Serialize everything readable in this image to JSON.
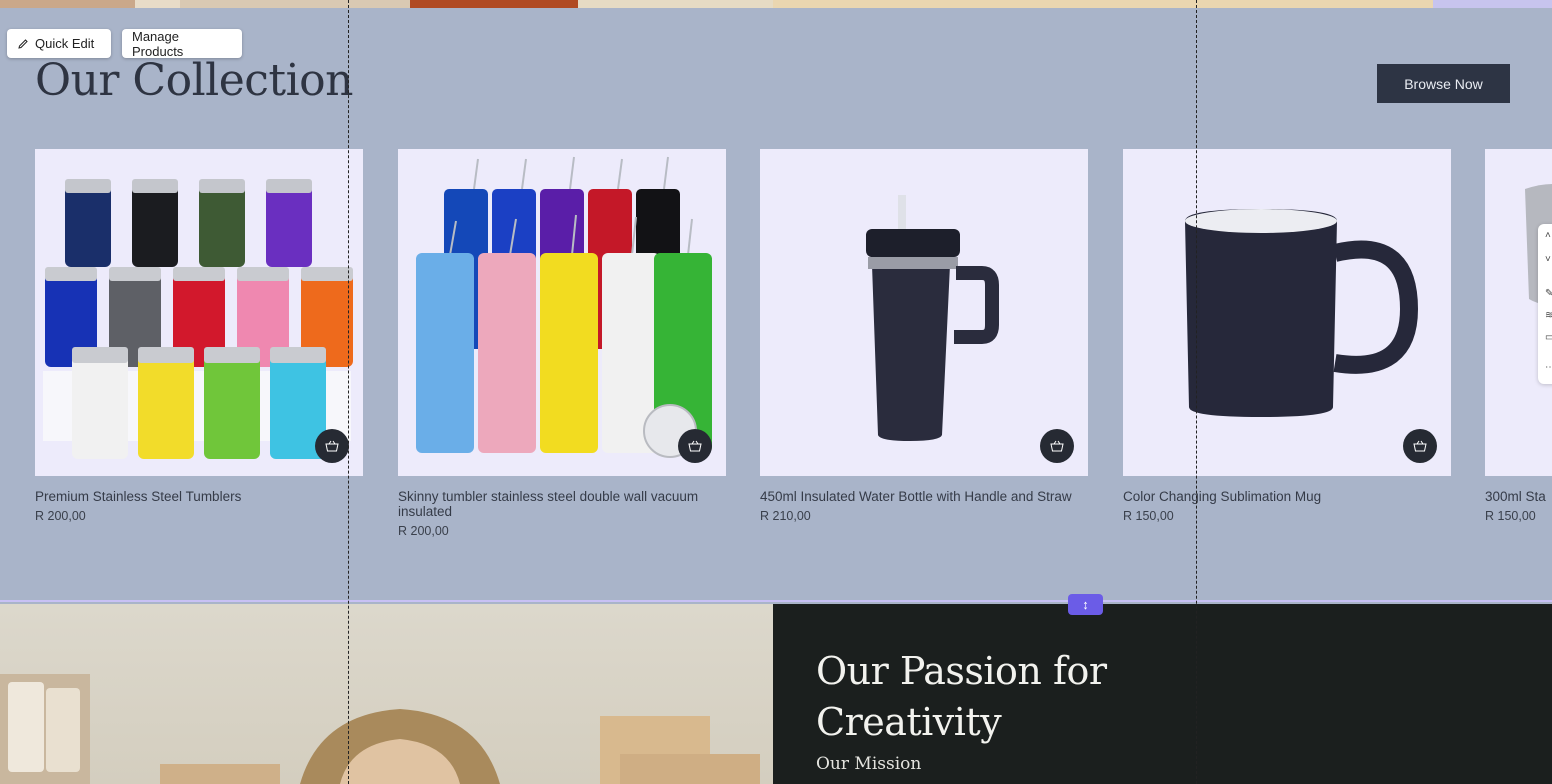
{
  "editor": {
    "quick_edit_label": "Quick Edit",
    "manage_products_label": "Manage Products",
    "resize_handle_glyph": "↕"
  },
  "collection": {
    "title": "Our Collection",
    "browse_label": "Browse Now",
    "products": [
      {
        "name": "Premium Stainless Steel Tumblers",
        "price": "R 200,00"
      },
      {
        "name": "Skinny tumbler stainless steel double wall vacuum insulated",
        "price": "R 200,00"
      },
      {
        "name": "450ml Insulated Water Bottle with Handle and Straw",
        "price": "R 210,00"
      },
      {
        "name": "Color Changing Sublimation Mug",
        "price": "R 150,00"
      },
      {
        "name": "300ml Sta",
        "price": "R 150,00"
      }
    ]
  },
  "about": {
    "heading_line1": "Our Passion for",
    "heading_line2": "Creativity",
    "subheading": "Our Mission"
  },
  "colors": {
    "section_bg": "#a9b4c9",
    "button_dark": "#2d3444",
    "accent_purple": "#6b5ce7",
    "dark_panel": "#1b1f1e"
  }
}
